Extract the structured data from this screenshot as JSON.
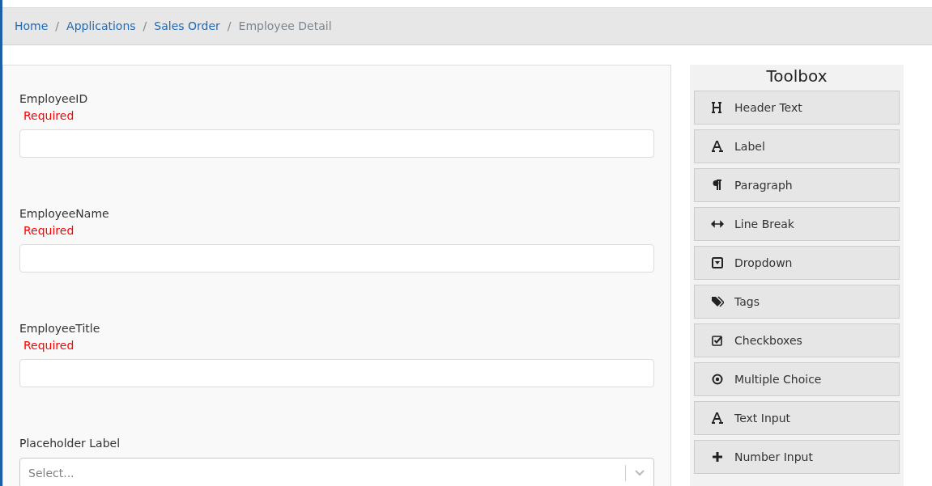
{
  "breadcrumb": [
    {
      "label": "Home",
      "current": false
    },
    {
      "label": "Applications",
      "current": false
    },
    {
      "label": "Sales Order",
      "current": false
    },
    {
      "label": "Employee Detail",
      "current": true
    }
  ],
  "breadcrumb_separator": "/",
  "form": {
    "fields": [
      {
        "kind": "text",
        "label": "EmployeeID",
        "required": "Required"
      },
      {
        "kind": "text",
        "label": "EmployeeName",
        "required": "Required"
      },
      {
        "kind": "text",
        "label": "EmployeeTitle",
        "required": "Required"
      },
      {
        "kind": "select",
        "label": "Placeholder Label",
        "placeholder": "Select..."
      }
    ]
  },
  "toolbox": {
    "title": "Toolbox",
    "items": [
      {
        "kind": "header",
        "label": "Header Text"
      },
      {
        "kind": "label",
        "label": "Label"
      },
      {
        "kind": "paragraph",
        "label": "Paragraph"
      },
      {
        "kind": "linebreak",
        "label": "Line Break"
      },
      {
        "kind": "dropdown",
        "label": "Dropdown"
      },
      {
        "kind": "tags",
        "label": "Tags"
      },
      {
        "kind": "checkboxes",
        "label": "Checkboxes"
      },
      {
        "kind": "radio",
        "label": "Multiple Choice"
      },
      {
        "kind": "textinput",
        "label": "Text Input"
      },
      {
        "kind": "number",
        "label": "Number Input"
      }
    ]
  }
}
